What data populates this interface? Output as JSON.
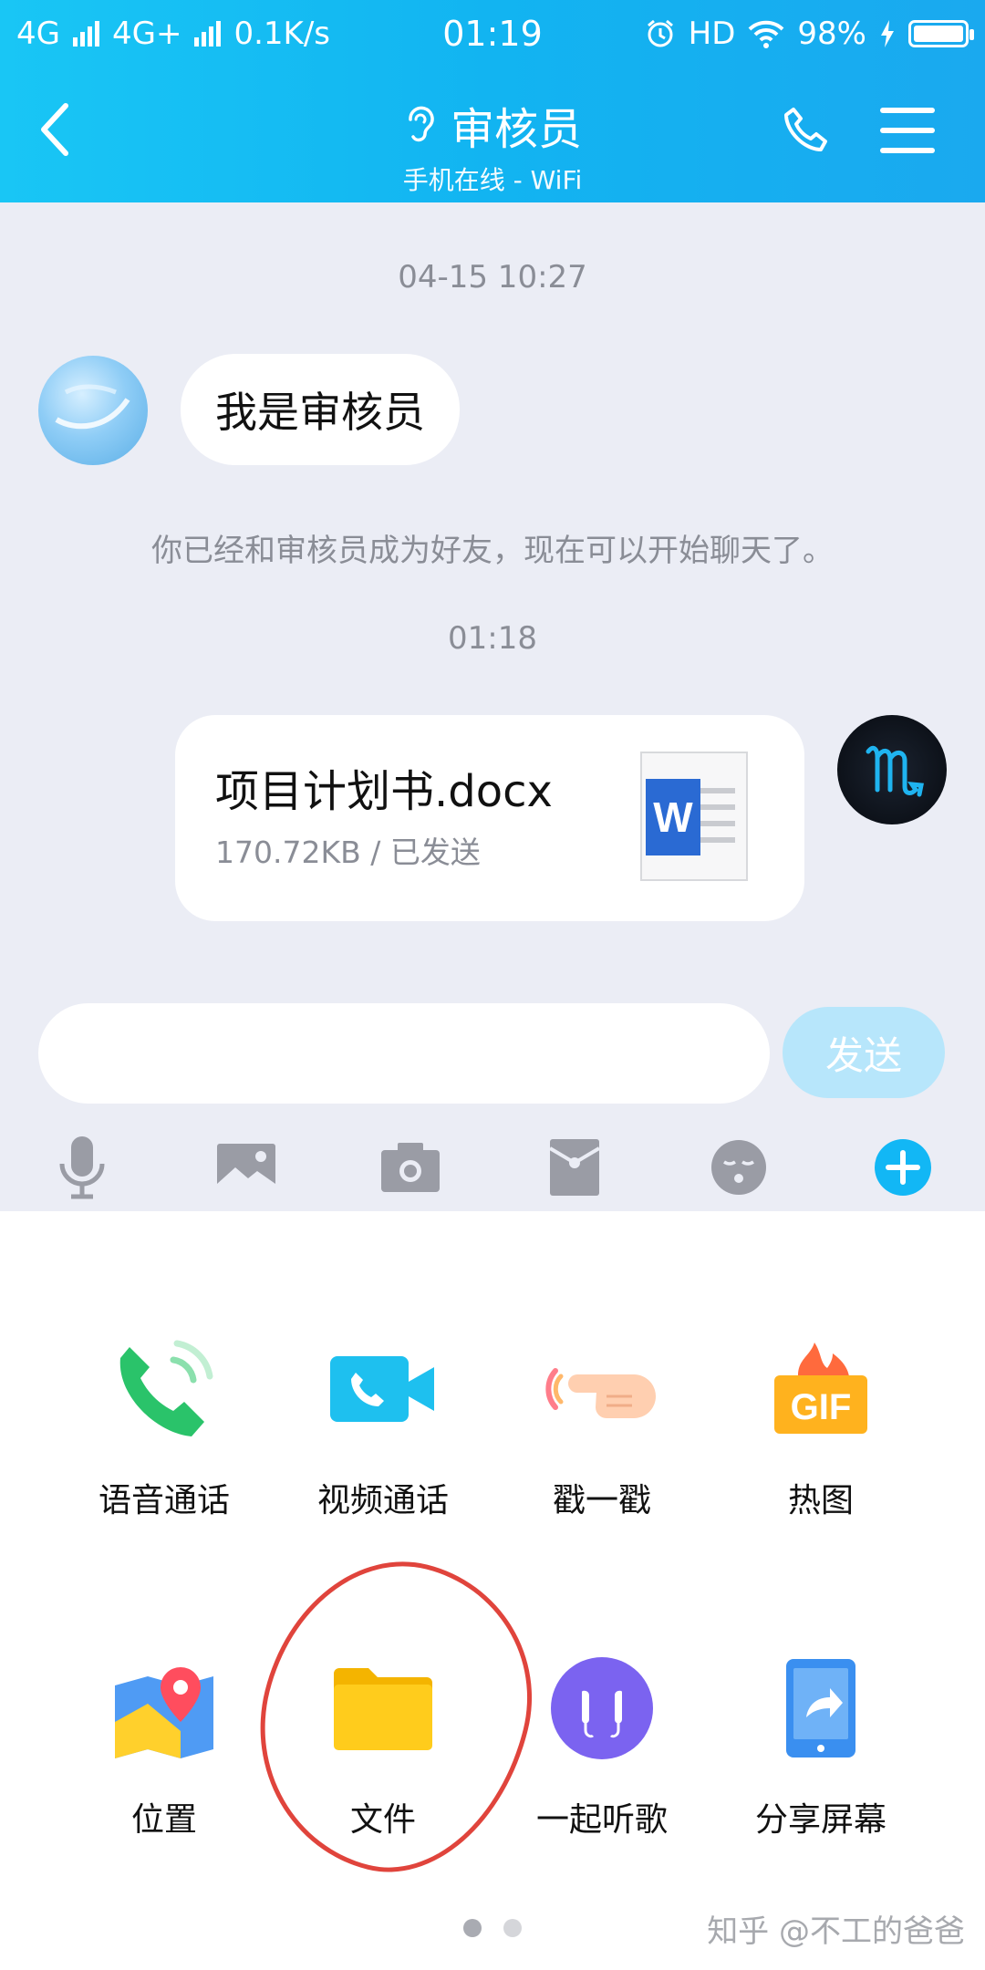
{
  "status_bar": {
    "network1": "4G",
    "network2": "4G+",
    "speed": "0.1K/s",
    "time": "01:19",
    "hd": "HD",
    "battery": "98%"
  },
  "header": {
    "title": "审核员",
    "subtitle": "手机在线 - WiFi"
  },
  "chat": {
    "timestamp1": "04-15 10:27",
    "message1": "我是审核员",
    "system_note": "你已经和审核员成为好友，现在可以开始聊天了。",
    "timestamp2": "01:18",
    "file": {
      "name": "项目计划书.docx",
      "meta": "170.72KB / 已发送",
      "icon_letter": "W"
    }
  },
  "input": {
    "placeholder": "",
    "send_label": "发送"
  },
  "toolbar": {
    "icons": [
      "microphone-icon",
      "image-icon",
      "camera-icon",
      "red-packet-icon",
      "emoji-icon",
      "plus-icon"
    ]
  },
  "panel": {
    "row1": [
      {
        "label": "语音通话",
        "icon": "phone-call-icon"
      },
      {
        "label": "视频通话",
        "icon": "video-call-icon"
      },
      {
        "label": "戳一戳",
        "icon": "poke-icon"
      },
      {
        "label": "热图",
        "icon": "gif-icon"
      }
    ],
    "row2": [
      {
        "label": "位置",
        "icon": "location-icon"
      },
      {
        "label": "文件",
        "icon": "folder-icon"
      },
      {
        "label": "一起听歌",
        "icon": "headphones-icon"
      },
      {
        "label": "分享屏幕",
        "icon": "share-screen-icon"
      }
    ],
    "gif_text": "GIF",
    "pages": 2,
    "active_page": 1
  },
  "watermark": "知乎 @不工的爸爸",
  "colors": {
    "header": "#12b4f1",
    "chat_bg": "#ebedf5",
    "send_disabled": "#b7e6fb",
    "annotation": "#e0443c"
  }
}
